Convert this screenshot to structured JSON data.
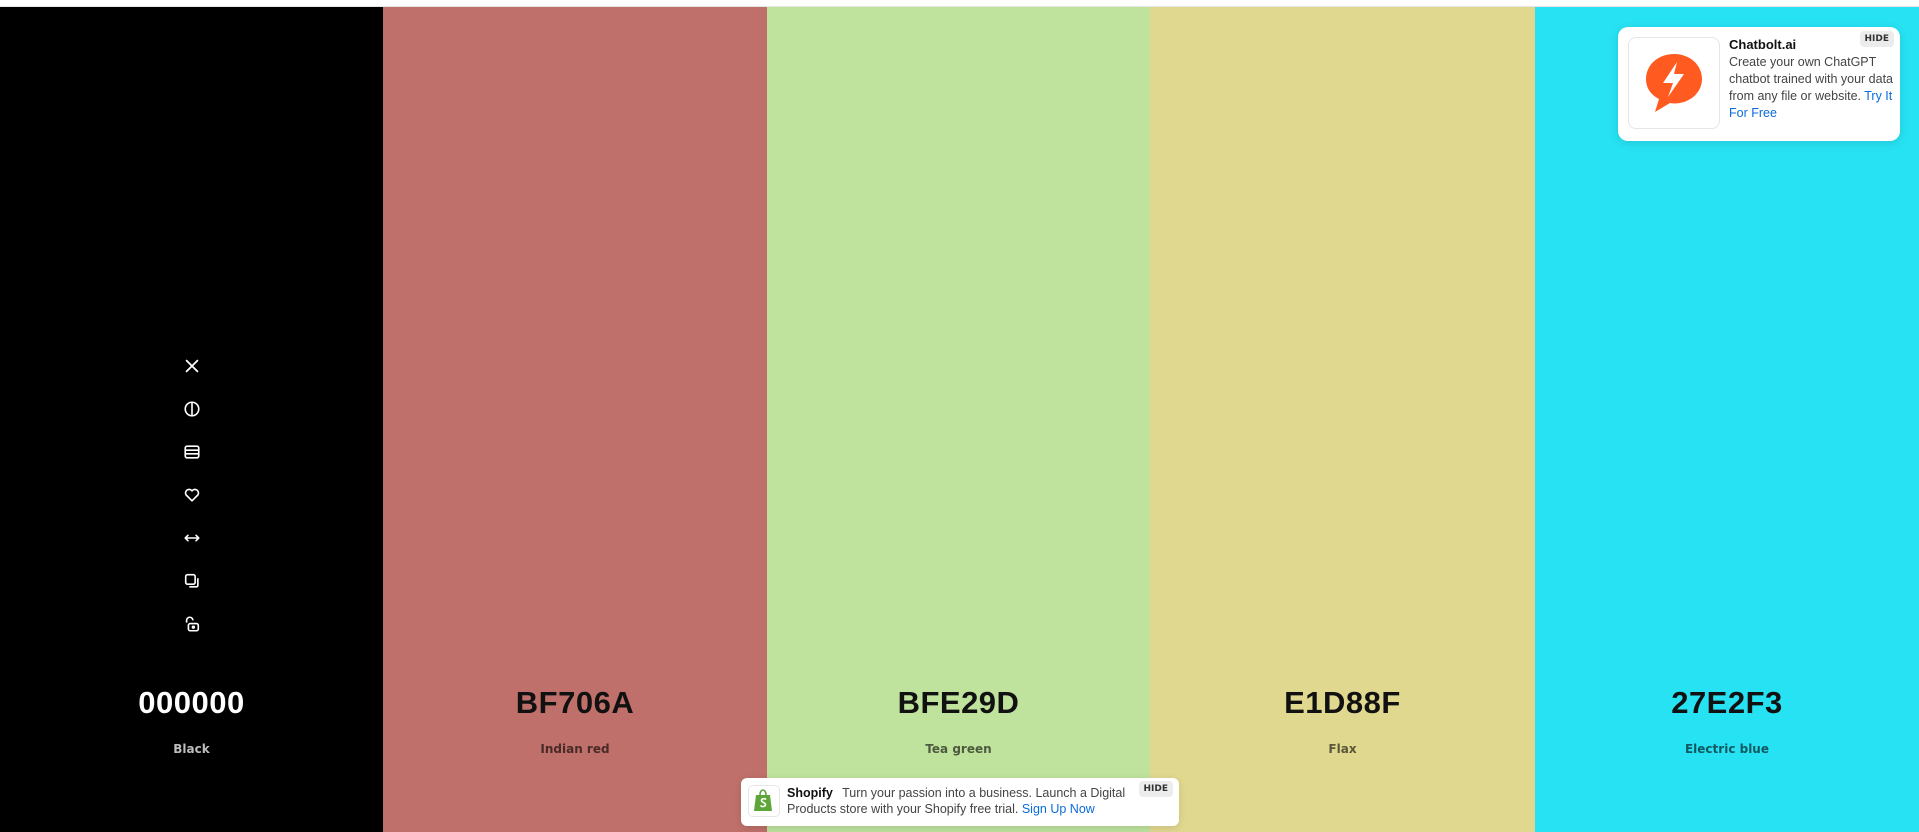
{
  "palette": {
    "colors": [
      {
        "hex": "000000",
        "name": "Black",
        "bg": "#000000",
        "text_color": "#ffffff",
        "name_color": "#bdbdbd"
      },
      {
        "hex": "BF706A",
        "name": "Indian red",
        "bg": "#bf706a",
        "text_color": "#111111",
        "name_color": "#4a2a28"
      },
      {
        "hex": "BFE29D",
        "name": "Tea green",
        "bg": "#bfe29d",
        "text_color": "#111111",
        "name_color": "#4d5a3f"
      },
      {
        "hex": "E1D88F",
        "name": "Flax",
        "bg": "#e1d88f",
        "text_color": "#111111",
        "name_color": "#5a5639"
      },
      {
        "hex": "27E2F3",
        "name": "Electric blue",
        "bg": "#27e2f3",
        "text_color": "#111111",
        "name_color": "#0f5a61"
      }
    ],
    "tools": [
      {
        "name": "remove-color-icon",
        "title": "Remove color"
      },
      {
        "name": "shades-icon",
        "title": "View shades"
      },
      {
        "name": "drag-icon",
        "title": "Drag"
      },
      {
        "name": "heart-icon",
        "title": "Save color"
      },
      {
        "name": "swap-icon",
        "title": "Move"
      },
      {
        "name": "copy-icon",
        "title": "Copy hex"
      },
      {
        "name": "lock-icon",
        "title": "Toggle lock"
      }
    ]
  },
  "ads": {
    "top": {
      "brand": "Chatbolt.ai",
      "text": "Create your own ChatGPT chatbot trained with your data from any file or website.",
      "cta": "Try It For Free",
      "hide": "HIDE",
      "brand_color": "#ff5a1f"
    },
    "bottom": {
      "brand": "Shopify",
      "text": "Turn your passion into a business. Launch a Digital Products store with your Shopify free trial.",
      "cta": "Sign Up Now",
      "hide": "HIDE",
      "brand_color": "#5ea53a"
    }
  }
}
